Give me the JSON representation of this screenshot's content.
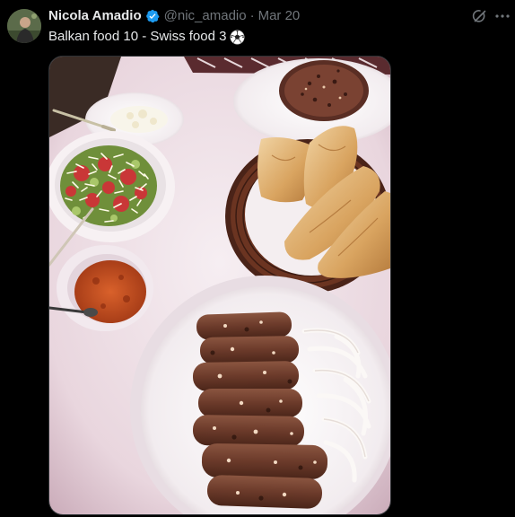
{
  "author": {
    "display_name": "Nicola Amadio",
    "handle": "@nic_amadio",
    "separator": "·",
    "date": "Mar 20",
    "verified": true,
    "avatar_icon": "avatar-image"
  },
  "post": {
    "text": "Balkan food 10 - Swiss food 3",
    "emoji_icon": "soccer-ball-icon",
    "media": {
      "kind": "photo",
      "subject": "plate of cevapi with raw onion, bread rolls in a wicker basket, shopska salad, ajvar, pljeskavica"
    }
  },
  "actions": {
    "grok_icon": "grok-icon",
    "more_icon": "more-dots-icon"
  },
  "colors": {
    "background": "#000000",
    "text_primary": "#e7e9ea",
    "text_secondary": "#71767b",
    "verified_blue": "#1d9bf0"
  }
}
